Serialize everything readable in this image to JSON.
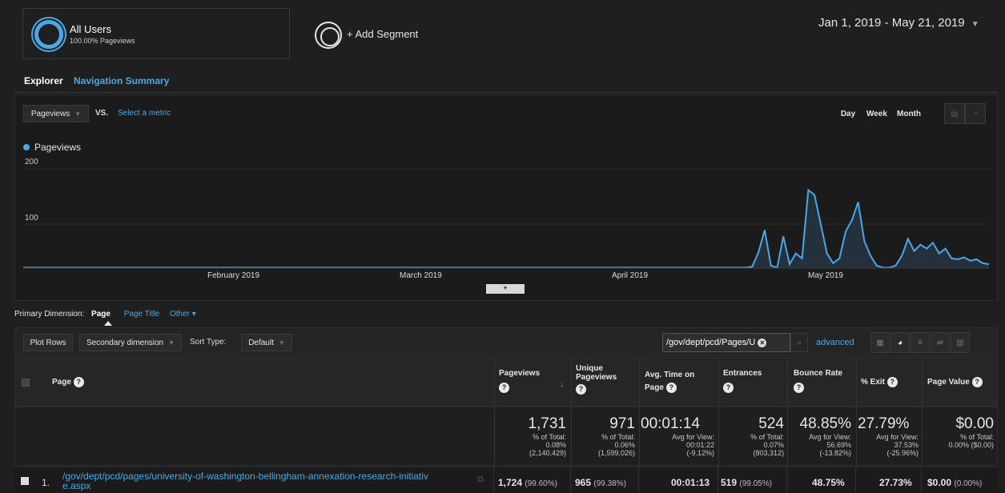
{
  "segments": {
    "active": {
      "name": "All Users",
      "sub": "100.00% Pageviews"
    },
    "add_label": "+ Add Segment"
  },
  "date_range": "Jan 1, 2019 - May 21, 2019",
  "tabs": [
    {
      "label": "Explorer",
      "active": true
    },
    {
      "label": "Navigation Summary",
      "active": false
    }
  ],
  "graph_controls": {
    "metric": "Pageviews",
    "vs": "VS.",
    "select_metric": "Select a metric",
    "granularity": [
      "Day",
      "Week",
      "Month"
    ]
  },
  "chart_data": {
    "type": "area",
    "legend": "Pageviews",
    "yticks": [
      "200",
      "100"
    ],
    "ylim": [
      0,
      200
    ],
    "xlabels": [
      "February 2019",
      "March 2019",
      "April 2019",
      "May 2019"
    ],
    "x_start": "2019-01-01",
    "x_end": "2019-05-21",
    "values": [
      1,
      1,
      1,
      1,
      1,
      1,
      1,
      1,
      1,
      1,
      1,
      1,
      1,
      1,
      1,
      1,
      1,
      1,
      1,
      1,
      1,
      1,
      1,
      1,
      1,
      1,
      1,
      1,
      1,
      1,
      1,
      1,
      1,
      1,
      1,
      1,
      1,
      1,
      1,
      1,
      1,
      1,
      1,
      1,
      1,
      1,
      1,
      1,
      1,
      1,
      1,
      1,
      1,
      1,
      1,
      1,
      1,
      1,
      1,
      1,
      1,
      1,
      1,
      1,
      1,
      1,
      1,
      1,
      1,
      1,
      1,
      1,
      1,
      1,
      1,
      1,
      1,
      1,
      1,
      1,
      1,
      1,
      1,
      1,
      1,
      1,
      1,
      1,
      1,
      1,
      1,
      1,
      1,
      1,
      1,
      1,
      1,
      1,
      1,
      1,
      1,
      1,
      1,
      1,
      1,
      1,
      1,
      1,
      1,
      1,
      1,
      1,
      1,
      1,
      1,
      1,
      1,
      3,
      32,
      78,
      5,
      1,
      65,
      8,
      30,
      20,
      160,
      150,
      90,
      30,
      10,
      20,
      75,
      98,
      135,
      55,
      25,
      5,
      1,
      1,
      5,
      25,
      60,
      35,
      48,
      40,
      52,
      30,
      40,
      20,
      18,
      22,
      15,
      18,
      10,
      8
    ]
  },
  "dimension": {
    "label": "Primary Dimension:",
    "options": [
      "Page",
      "Page Title",
      "Other"
    ]
  },
  "toolbar": {
    "plot_rows": "Plot Rows",
    "secondary": "Secondary dimension",
    "sort_type_label": "Sort Type:",
    "sort_type_value": "Default",
    "filter_value": "/gov/dept/pcd/Pages/U",
    "advanced": "advanced"
  },
  "table": {
    "headers": {
      "page": "Page",
      "pageviews": "Pageviews",
      "unique1": "Unique",
      "unique2": "Pageviews",
      "avgtime1": "Avg. Time on",
      "avgtime2": "Page",
      "entrances": "Entrances",
      "bounce": "Bounce Rate",
      "exit": "% Exit",
      "value": "Page Value"
    },
    "totals": {
      "pageviews": {
        "big": "1,731",
        "l1": "% of Total:",
        "l2": "0.08%",
        "l3": "(2,140,429)"
      },
      "unique": {
        "big": "971",
        "l1": "% of Total:",
        "l2": "0.06%",
        "l3": "(1,599,026)"
      },
      "avgtime": {
        "big": "00:01:14",
        "l1": "Avg for View:",
        "l2": "00:01:22",
        "l3": "(-9.12%)"
      },
      "entrances": {
        "big": "524",
        "l1": "% of Total:",
        "l2": "0.07%",
        "l3": "(803,312)"
      },
      "bounce": {
        "big": "48.85%",
        "l1": "Avg for View:",
        "l2": "56.69%",
        "l3": "(-13.82%)"
      },
      "exit": {
        "big": "27.79%",
        "l1": "Avg for View:",
        "l2": "37.53%",
        "l3": "(-25.96%)"
      },
      "value": {
        "big": "$0.00",
        "l1": "% of Total:",
        "l2": "0.00% ($0.00)",
        "l3": ""
      }
    },
    "row1": {
      "index": "1.",
      "page": "/gov/dept/pcd/pages/university-of-washington-bellingham-annexation-research-initiativ",
      "page2": "e.aspx",
      "pageviews": "1,724",
      "pageviews_pct": "(99.60%)",
      "unique": "965",
      "unique_pct": "(99.38%)",
      "avgtime": "00:01:13",
      "entrances": "519",
      "entrances_pct": "(99.05%)",
      "bounce": "48.75%",
      "exit": "27.73%",
      "value": "$0.00",
      "value_pct": "(0.00%)"
    }
  }
}
